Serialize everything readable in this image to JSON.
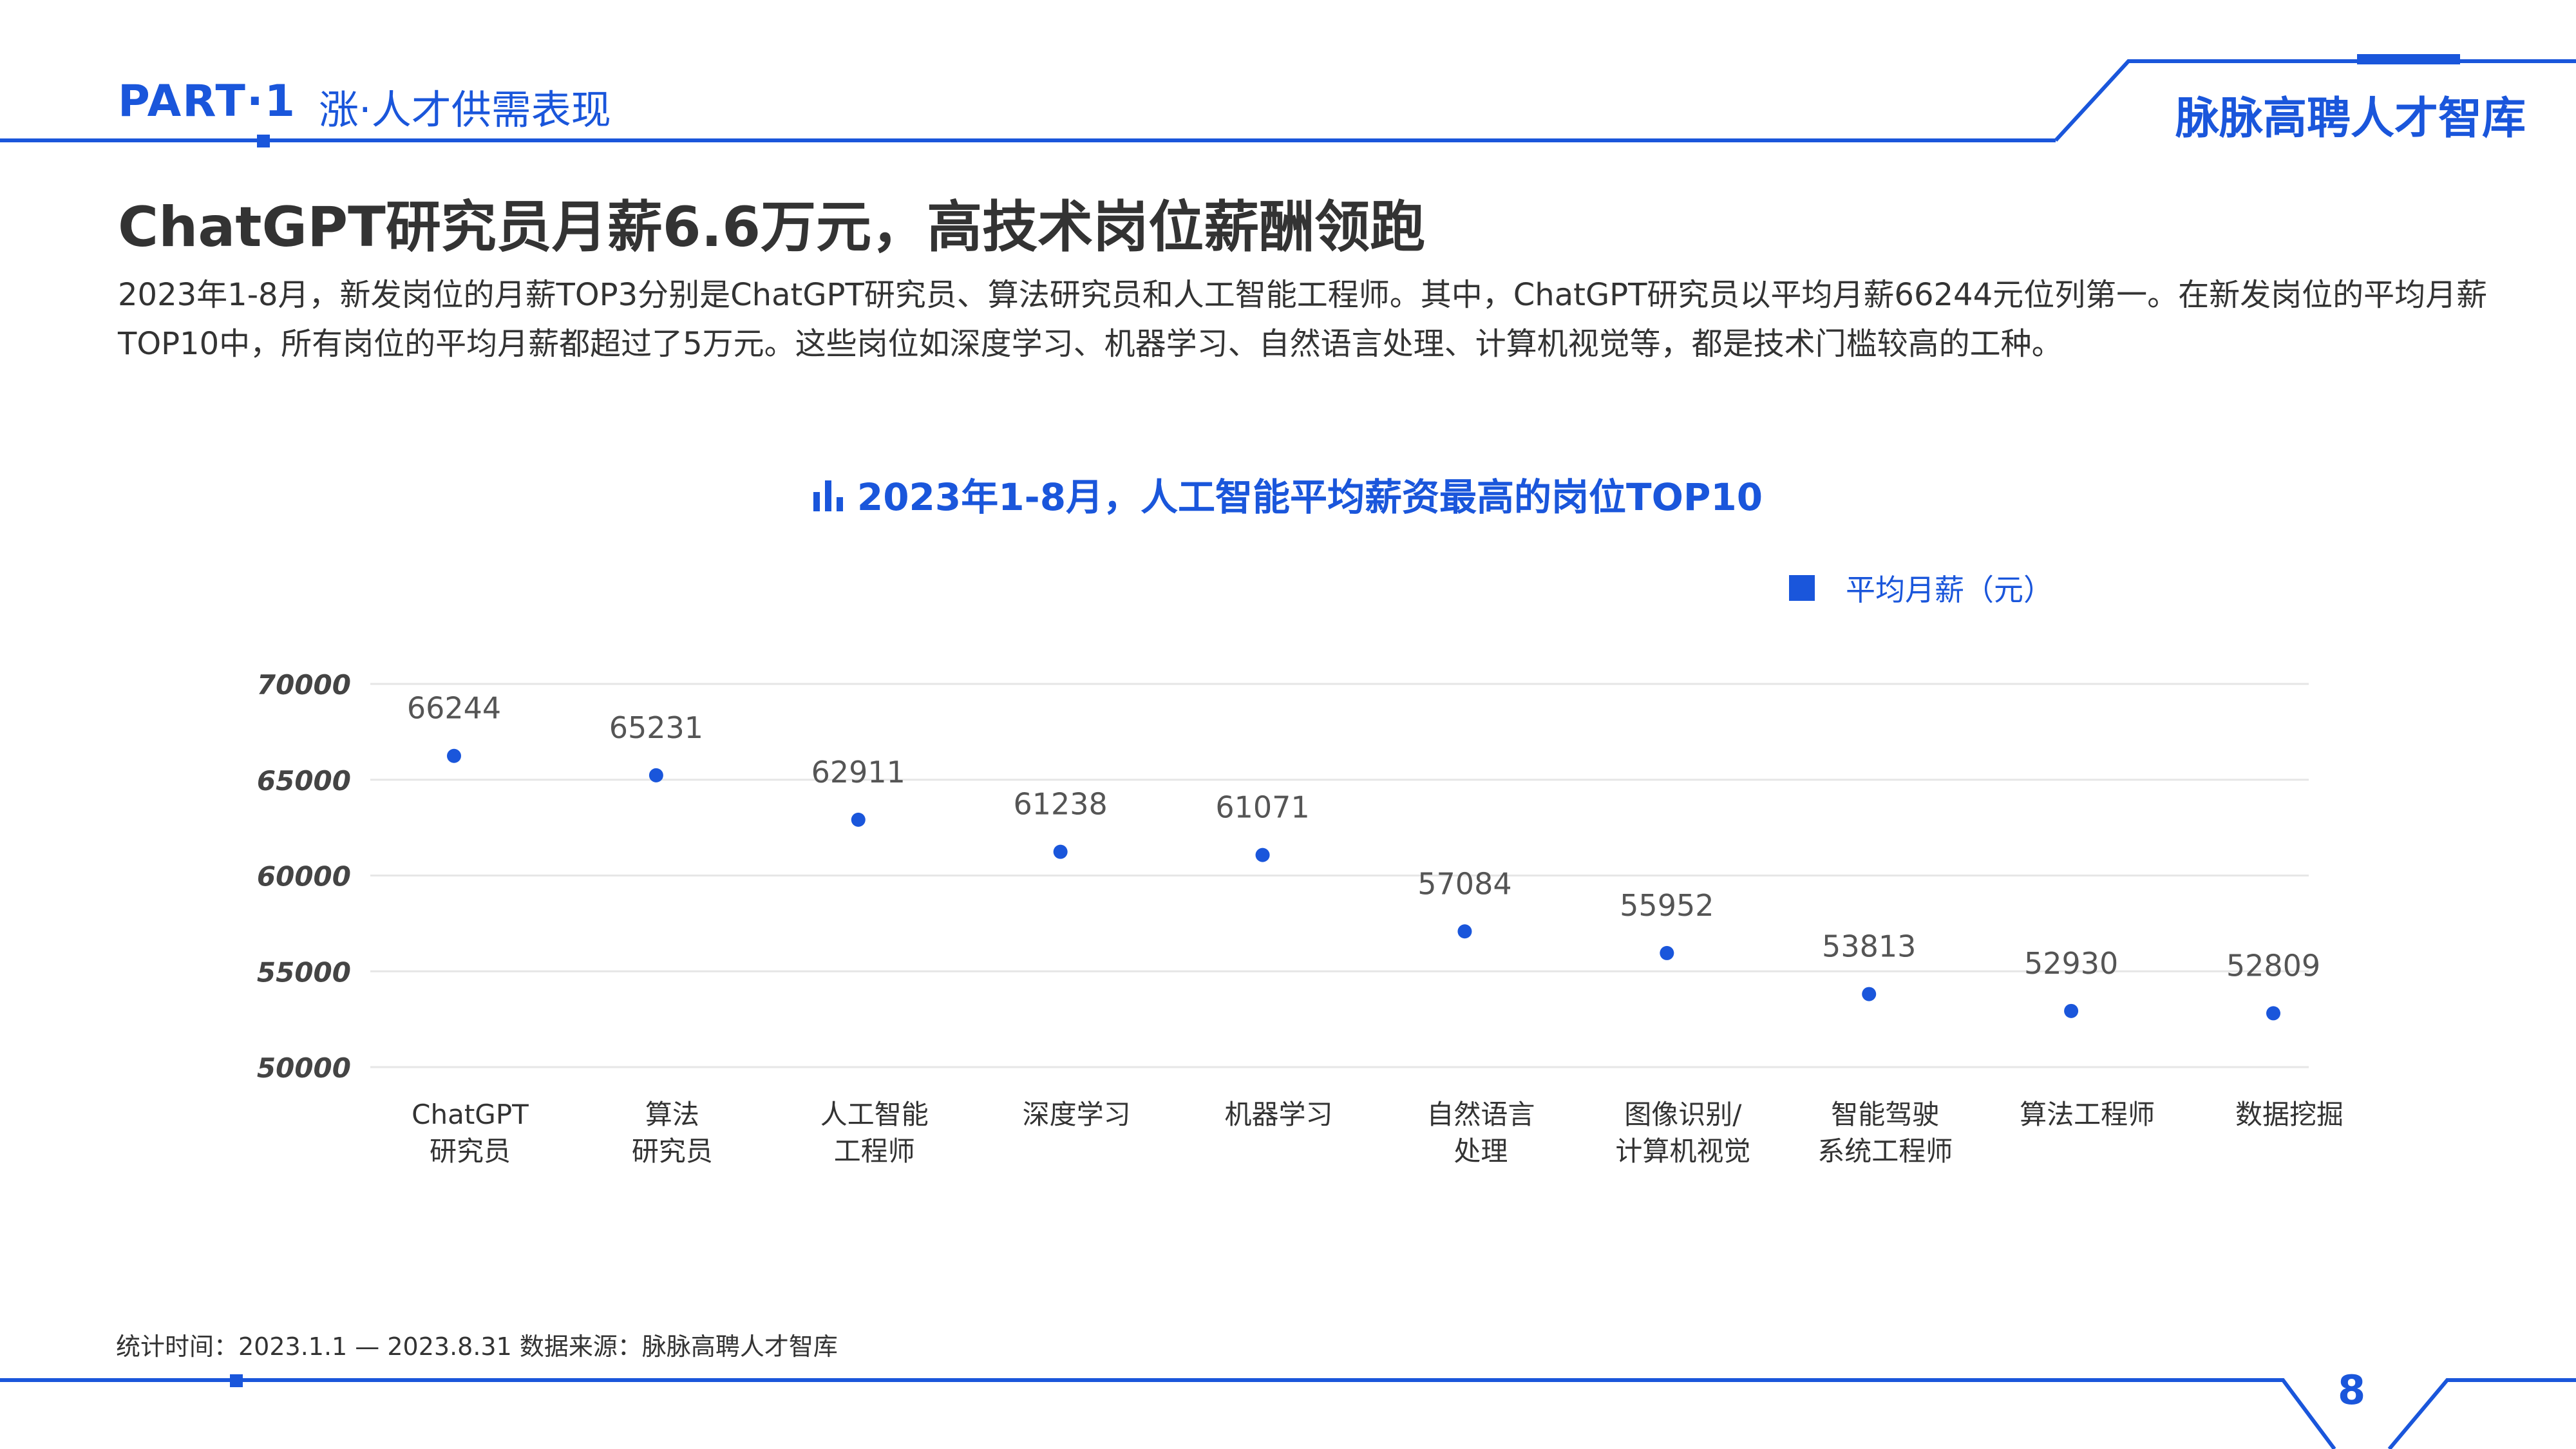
{
  "header": {
    "part": "PART·1",
    "section": "涨·人才供需表现",
    "brand": "脉脉高聘人才智库"
  },
  "page": {
    "title": "ChatGPT研究员月薪6.6万元，高技术岗位薪酬领跑",
    "description": "2023年1-8月，新发岗位的月薪TOP3分别是ChatGPT研究员、算法研究员和人工智能工程师。其中，ChatGPT研究员以平均月薪66244元位列第一。在新发岗位的平均月薪TOP10中，所有岗位的平均月薪都超过了5万元。这些岗位如深度学习、机器学习、自然语言处理、计算机视觉等，都是技术门槛较高的工种。"
  },
  "footer": {
    "note": "统计时间：2023.1.1 — 2023.8.31   数据来源：脉脉高聘人才智库",
    "page_number": "8"
  },
  "colors": {
    "accent": "#1a56db",
    "text": "#333333",
    "grid": "#e6e6e6"
  },
  "chart_data": {
    "type": "scatter",
    "title": "2023年1-8月，人工智能平均薪资最高的岗位TOP10",
    "categories": [
      [
        "ChatGPT",
        "研究员"
      ],
      [
        "算法",
        "研究员"
      ],
      [
        "人工智能",
        "工程师"
      ],
      [
        "深度学习"
      ],
      [
        "机器学习"
      ],
      [
        "自然语言",
        "处理"
      ],
      [
        "图像识别/",
        "计算机视觉"
      ],
      [
        "智能驾驶",
        "系统工程师"
      ],
      [
        "算法工程师"
      ],
      [
        "数据挖掘"
      ]
    ],
    "series": [
      {
        "name": "平均月薪（元）",
        "values": [
          66244,
          65231,
          62911,
          61238,
          61071,
          57084,
          55952,
          53813,
          52930,
          52809
        ]
      }
    ],
    "yticks": [
      50000,
      55000,
      60000,
      65000,
      70000
    ],
    "ylim": [
      50000,
      70000
    ],
    "grid": true,
    "legend_position": "top-right",
    "data_labels": true
  }
}
